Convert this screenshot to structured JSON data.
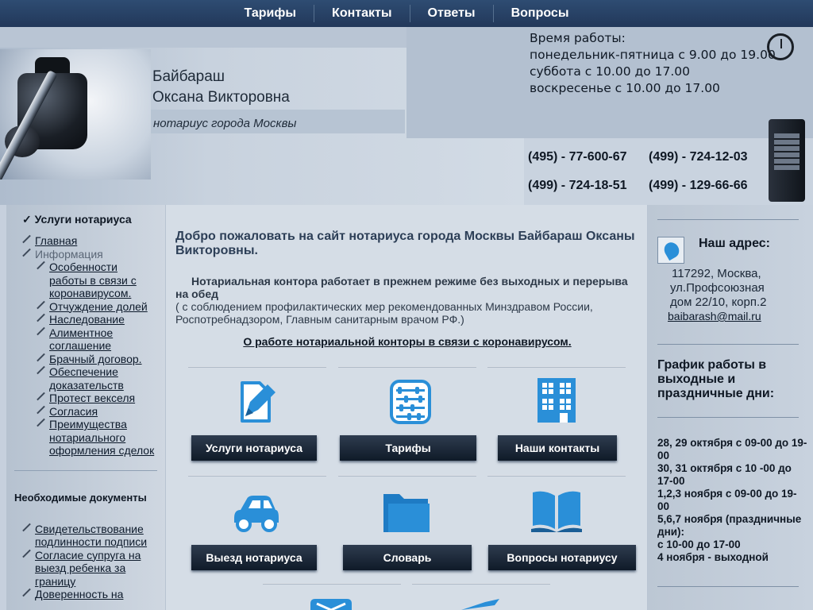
{
  "nav": {
    "items": [
      "Тарифы",
      "Контакты",
      "Ответы",
      "Вопросы"
    ]
  },
  "header": {
    "name_line1": "Байбараш",
    "name_line2": "Оксана Викторовна",
    "subtitle": "нотариус города Москвы",
    "hours": [
      "Время работы:",
      "понедельник-пятница с 9.00 до 19.00",
      "суббота  с 10.00 до 17.00",
      "воскресенье с 10.00 до 17.00"
    ],
    "phones": [
      "(495) - 77-600-67",
      "(499) - 724-12-03",
      "(499) - 724-18-51",
      "(499) - 129-66-66"
    ]
  },
  "left": {
    "title": "Услуги нотариуса",
    "menu": [
      {
        "label": "Главная",
        "type": "link"
      },
      {
        "label": "Информация",
        "type": "info"
      },
      {
        "label": "Особенности работы в связи с коронавирусом.",
        "type": "sub"
      },
      {
        "label": "Отчуждение долей",
        "type": "sub"
      },
      {
        "label": "Наследование",
        "type": "sub"
      },
      {
        "label": "Алиментное соглашение",
        "type": "sub"
      },
      {
        "label": "Брачный договор.",
        "type": "sub"
      },
      {
        "label": "Обеспечение доказательств",
        "type": "sub"
      },
      {
        "label": "Протест векселя",
        "type": "sub"
      },
      {
        "label": "Согласия",
        "type": "sub"
      },
      {
        "label": "Преимущества нотариального оформления сделок",
        "type": "sub"
      }
    ],
    "docs_title": "Необходимые документы",
    "docs": [
      "Свидетельствование подлинности подписи",
      "Согласие супруга на выезд ребенка за границу",
      "Доверенность на"
    ]
  },
  "main": {
    "welcome": "Добро пожаловать на сайт нотариуса города Москвы Байбараш Оксаны Викторовны.",
    "notice_bold": "Нотариальная контора работает в прежнем режиме без выходных и перерыва на обед",
    "notice_text": "( с соблюдением профилактических мер рекомендованных Минздравом России, Роспотребнадзором, Главным санитарным врачом РФ.)",
    "covid_link": "О работе нотариальной конторы в связи с коронавирусом.",
    "tiles": [
      "Услуги нотариуса",
      "Тарифы",
      "Наши контакты",
      "Выезд нотариуса",
      "Словарь",
      "Вопросы нотариусу"
    ],
    "icon_names": [
      "edit-document-icon",
      "abacus-icon",
      "building-icon",
      "car-icon",
      "folder-icon",
      "book-icon"
    ]
  },
  "right": {
    "addr_title": "Наш адрес:",
    "addr_lines": [
      "117292, Москва,",
      "ул.Профсоюзная",
      "дом 22/10, корп.2"
    ],
    "email": "baibarash@mail.ru",
    "sched_title": "График работы в выходные и праздничные дни:",
    "sched_lines": [
      "28, 29 октября с 09-00 до 19-00",
      "30, 31 октября с 10 -00 до 17-00",
      "1,2,3 ноября с 09-00 до 19-00",
      "5,6,7 ноября (праздничные дни):",
      "с 10-00 до 17-00",
      "4 ноября - выходной"
    ]
  },
  "colors": {
    "accent": "#2a8fd8",
    "nav_bg": "#2e4c72",
    "button_bg": "#1c2a3c"
  }
}
